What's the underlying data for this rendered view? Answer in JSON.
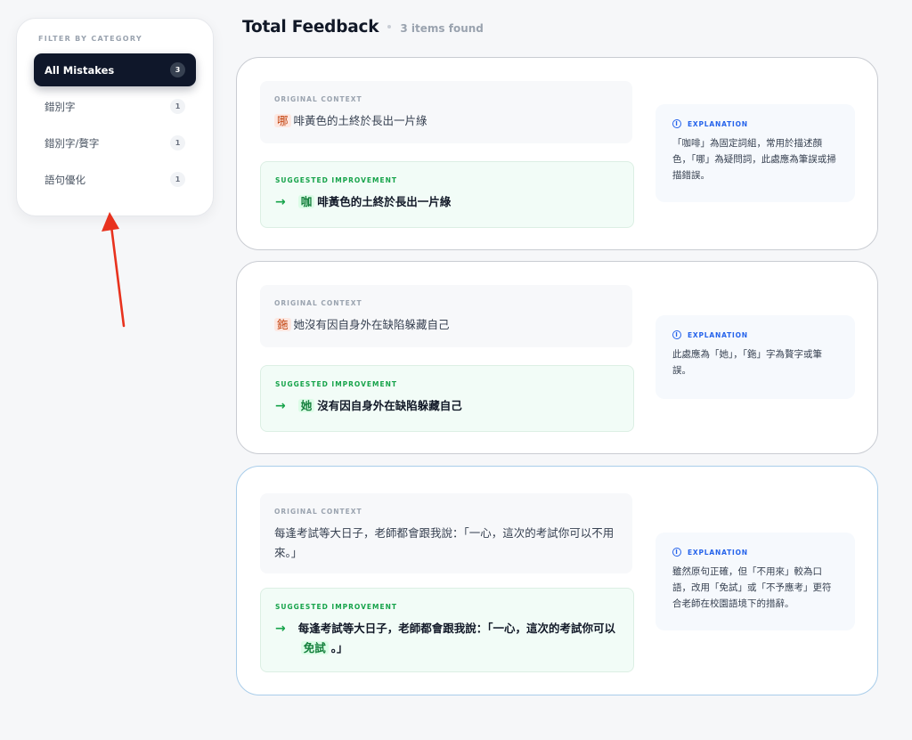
{
  "sidebar": {
    "title": "FILTER BY CATEGORY",
    "items": [
      {
        "label": "All Mistakes",
        "count": "3"
      },
      {
        "label": "錯別字",
        "count": "1"
      },
      {
        "label": "錯別字/贅字",
        "count": "1"
      },
      {
        "label": "語句優化",
        "count": "1"
      }
    ]
  },
  "header": {
    "title": "Total Feedback",
    "count_text": "3 items found"
  },
  "labels": {
    "original": "ORIGINAL CONTEXT",
    "suggested": "SUGGESTED IMPROVEMENT",
    "explanation": "EXPLANATION",
    "arrow": "→",
    "info": "i"
  },
  "cards": [
    {
      "orig_mark": "哪",
      "orig_rest": "啡黃色的土終於長出一片綠",
      "sug_mark": "咖",
      "sug_rest": "啡黃色的土終於長出一片綠",
      "explanation": "「咖啡」為固定詞組，常用於描述顏色，「哪」為疑問詞，此處應為筆誤或掃描錯誤。"
    },
    {
      "orig_mark": "鉇",
      "orig_rest": "她沒有因自身外在缺陷躲藏自己",
      "sug_mark": "她",
      "sug_rest": "沒有因自身外在缺陷躲藏自己",
      "explanation": "此處應為「她」，「鉇」字為贅字或筆誤。"
    },
    {
      "orig_text": "每逢考試等大日子，老師都會跟我說：「一心，這次的考試你可以不用來。」",
      "sug_before": "每逢考試等大日子，老師都會跟我說：「一心，這次的考試你可以",
      "sug_mark": "免試",
      "sug_after": "。」",
      "explanation": "雖然原句正確，但「不用來」較為口語，改用「免試」或「不予應考」更符合老師在校園語境下的措辭。"
    }
  ],
  "colors": {
    "accent_dark": "#0f172a",
    "suggest_green": "#16a34a",
    "explain_blue": "#2563eb",
    "error_orange": "#c2410c"
  }
}
